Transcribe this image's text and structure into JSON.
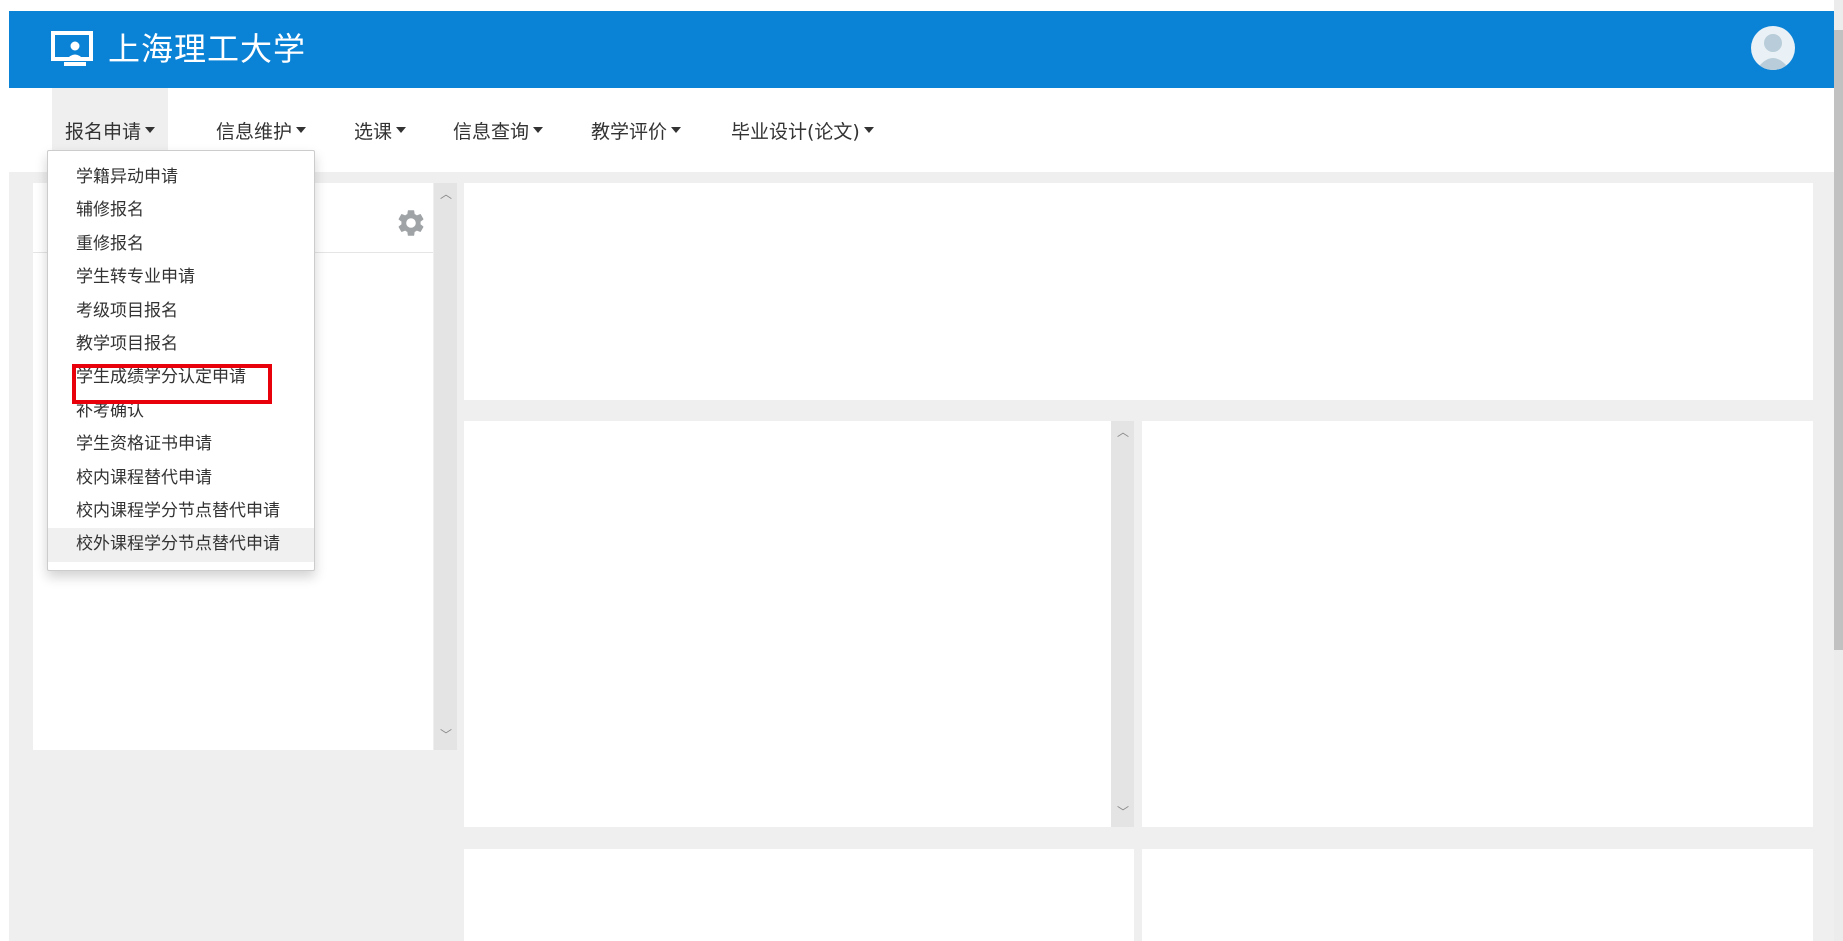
{
  "header": {
    "school_name": "上海理工大学",
    "logo_icon": "monitor-user-icon",
    "avatar_icon": "user-avatar-icon"
  },
  "nav": {
    "items": [
      {
        "label": "报名申请",
        "active": true
      },
      {
        "label": "信息维护",
        "active": false
      },
      {
        "label": "选课",
        "active": false
      },
      {
        "label": "信息查询",
        "active": false
      },
      {
        "label": "教学评价",
        "active": false
      },
      {
        "label": "毕业设计(论文)",
        "active": false
      }
    ]
  },
  "dropdown": {
    "items": [
      "学籍异动申请",
      "辅修报名",
      "重修报名",
      "学生转专业申请",
      "考级项目报名",
      "教学项目报名",
      "学生成绩学分认定申请",
      "补考确认",
      "学生资格证书申请",
      "校内课程替代申请",
      "校内课程学分节点替代申请",
      "校外课程学分节点替代申请"
    ],
    "highlighted_index": 6
  },
  "sidebar": {
    "settings_icon": "gear-icon"
  },
  "colors": {
    "header_bg": "#0a82d6",
    "page_bg": "#efefef",
    "highlight": "#e8000a"
  }
}
